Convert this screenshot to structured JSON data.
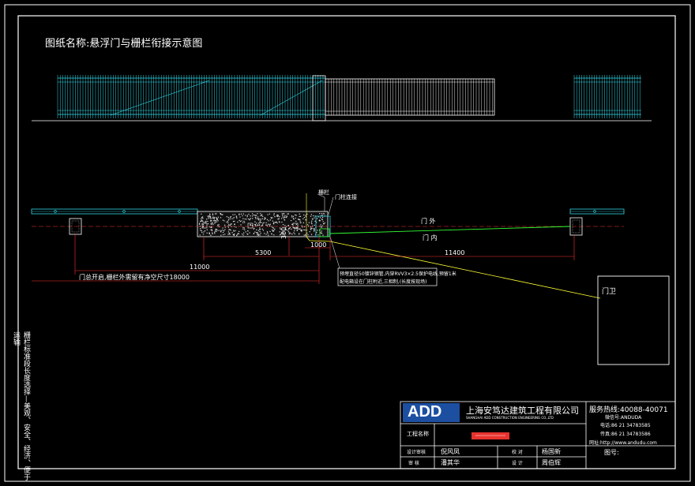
{
  "drawing": {
    "title": "图纸名称:悬浮门与栅栏衔接示意图",
    "side_note": "栅栏标准段长度选择—美观、安全、经济、便于运输"
  },
  "plan": {
    "label_pillar": "栅栏",
    "label_connector": "门柱连接",
    "label_outside": "门 外",
    "label_inside": "门 内",
    "dim_5300": "5300",
    "dim_300": "300",
    "dim_1000": "1000",
    "dim_11000": "11000",
    "dim_11400": "11400",
    "dim_18000": "门总开启,栅栏外需留有净空尺寸18000",
    "note_line1": "预埋直径50镀锌钢管,内穿RVV3×2.5保护电线,预留1米",
    "note_line2": "配电箱设在门柱附近,三相制,(长度按现场)",
    "guard_label": "门卫"
  },
  "title_block": {
    "logo": "ADD",
    "company_cn": "上海安笃达建筑工程有限公司",
    "company_en": "SHANGHAI ADD CONSTRUCTION ENGINEERING CO.,LTD",
    "hotline": "服务热线:40088-40071",
    "wechat": "微信号:ANDUDA",
    "tel": "电话:86 21 34783585",
    "fax": "传真:86 21 34783586",
    "web": "网址:http://www.andudu.com",
    "project_label": "工程名称",
    "drawing_no_label": "图号:",
    "row1_c1": "设计审核",
    "row1_c2": "倪风凤",
    "row1_c3": "校 对",
    "row1_c4": "杨国新",
    "row2_c1": "审 核",
    "row2_c2": "潘其华",
    "row2_c3": "设 计",
    "row2_c4": "周伯辉"
  },
  "colors": {
    "frame": "#ffffff",
    "fence": "#30d8e8",
    "gate": "#ffffff",
    "axis": "#ff3030",
    "dim": "#ff3030",
    "green": "#33ff33",
    "yellow": "#ffff33",
    "logo_bg": "#1c4fa0",
    "stamp": "#e8322e"
  }
}
